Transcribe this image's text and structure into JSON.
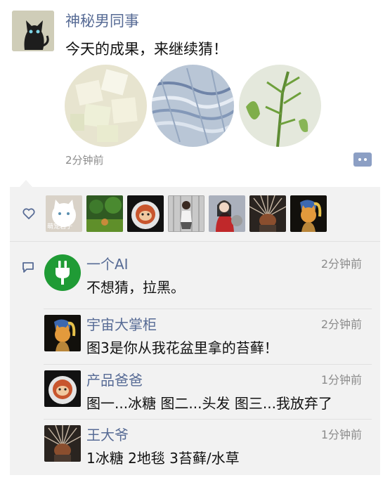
{
  "post": {
    "author": "神秘男同事",
    "text": "今天的成果，来继续猜！",
    "time": "2分钟前",
    "photos": [
      "photo-sugar-crystals",
      "photo-blue-fibers",
      "photo-green-moss"
    ]
  },
  "likes": {
    "icon": "heart-icon",
    "avatars": [
      {
        "name": "white-cat-avatar",
        "label": "萌宠君子"
      },
      {
        "name": "forest-avatar"
      },
      {
        "name": "sloth-astronaut-avatar"
      },
      {
        "name": "girl-photo-avatar"
      },
      {
        "name": "girl-cat-avatar"
      },
      {
        "name": "sunburst-avatar"
      },
      {
        "name": "cat-pearl-earring-avatar"
      }
    ]
  },
  "comments": {
    "icon": "comment-icon",
    "items": [
      {
        "author": "一个AI",
        "time": "2分钟前",
        "text": "不想猜，拉黑。",
        "avatar": "plug-icon"
      },
      {
        "author": "宇宙大掌柜",
        "time": "2分钟前",
        "text": "图3是你从我花盆里拿的苔藓！",
        "avatar": "cat-pearl-earring-avatar"
      },
      {
        "author": "产品爸爸",
        "time": "1分钟前",
        "text": "图一...冰糖 图二...头发 图三...我放弃了",
        "avatar": "sloth-astronaut-avatar"
      },
      {
        "author": "王大爷",
        "time": "1分钟前",
        "text": "1冰糖 2地毯 3苔藓/水草",
        "avatar": "sunburst-avatar"
      }
    ]
  },
  "colors": {
    "name_blue": "#576b95",
    "panel_bg": "#f2f2f2",
    "plug_green": "#1f9b35"
  }
}
